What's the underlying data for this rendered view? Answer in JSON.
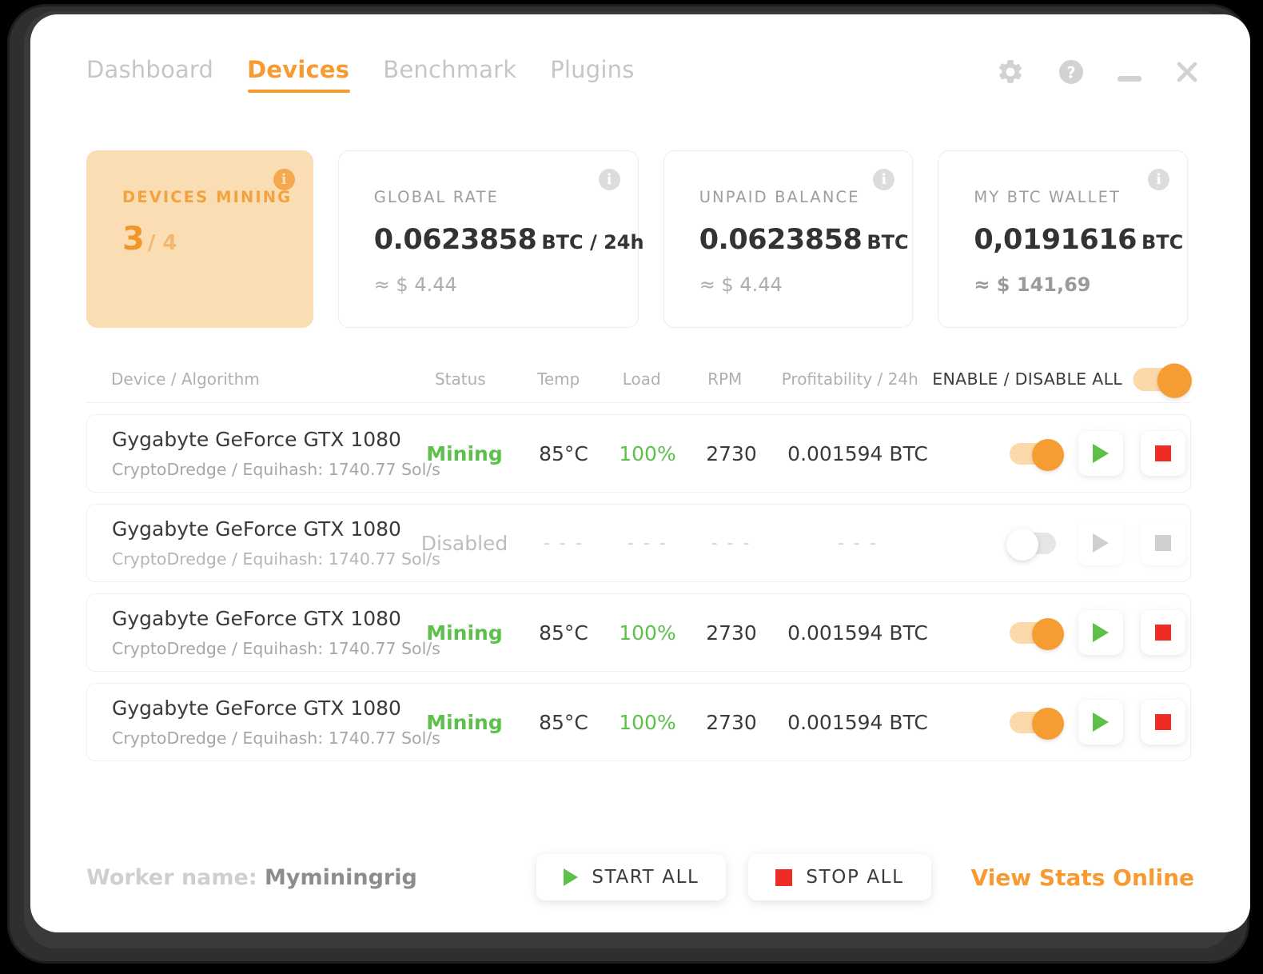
{
  "nav": {
    "tabs": [
      {
        "label": "Dashboard",
        "active": false
      },
      {
        "label": "Devices",
        "active": true
      },
      {
        "label": "Benchmark",
        "active": false
      },
      {
        "label": "Plugins",
        "active": false
      }
    ]
  },
  "window_controls": {
    "settings": "gear-icon",
    "help": "help-icon",
    "minimize": "minimize-icon",
    "close": "close-icon"
  },
  "cards": {
    "devices_mining": {
      "label": "DEVICES MINING",
      "count": "3",
      "total": "/ 4",
      "info": "i"
    },
    "global_rate": {
      "label": "GLOBAL RATE",
      "value": "0.0623858",
      "unit": "BTC / 24h",
      "sub": "≈ $ 4.44",
      "info": "i"
    },
    "unpaid_balance": {
      "label": "UNPAID BALANCE",
      "value": "0.0623858",
      "unit": "BTC",
      "sub": "≈ $ 4.44",
      "info": "i"
    },
    "btc_wallet": {
      "label": "MY BTC WALLET",
      "value": "0,0191616",
      "unit": "BTC",
      "sub": "≈ $ 141,69",
      "info": "i"
    }
  },
  "table": {
    "headers": {
      "device": "Device / Algorithm",
      "status": "Status",
      "temp": "Temp",
      "load": "Load",
      "rpm": "RPM",
      "profitability": "Profitability / 24h",
      "enable_all": "ENABLE / DISABLE ALL"
    },
    "enable_all_on": true,
    "rows": [
      {
        "name": "Gygabyte GeForce GTX 1080",
        "algo": "CryptoDredge / Equihash: 1740.77 Sol/s",
        "status": "Mining",
        "temp": "85°C",
        "load": "100%",
        "rpm": "2730",
        "profitability": "0.001594 BTC",
        "enabled": true
      },
      {
        "name": "Gygabyte GeForce GTX 1080",
        "algo": "CryptoDredge / Equihash: 1740.77 Sol/s",
        "status": "Disabled",
        "temp": "- - -",
        "load": "- - -",
        "rpm": "- - -",
        "profitability": "- - -",
        "enabled": false
      },
      {
        "name": "Gygabyte GeForce GTX 1080",
        "algo": "CryptoDredge / Equihash: 1740.77 Sol/s",
        "status": "Mining",
        "temp": "85°C",
        "load": "100%",
        "rpm": "2730",
        "profitability": "0.001594 BTC",
        "enabled": true
      },
      {
        "name": "Gygabyte GeForce GTX 1080",
        "algo": "CryptoDredge / Equihash: 1740.77 Sol/s",
        "status": "Mining",
        "temp": "85°C",
        "load": "100%",
        "rpm": "2730",
        "profitability": "0.001594 BTC",
        "enabled": true
      }
    ]
  },
  "footer": {
    "worker_label": "Worker name:",
    "worker_name": "Myminingrig",
    "start_all": "START ALL",
    "stop_all": "STOP ALL",
    "view_stats": "View Stats Online"
  },
  "colors": {
    "accent": "#f79a31",
    "accent_soft": "#fbddb3",
    "green": "#5cc04a",
    "red": "#ef2b26",
    "text": "#3a3a3a",
    "muted": "#b0b0b0"
  }
}
